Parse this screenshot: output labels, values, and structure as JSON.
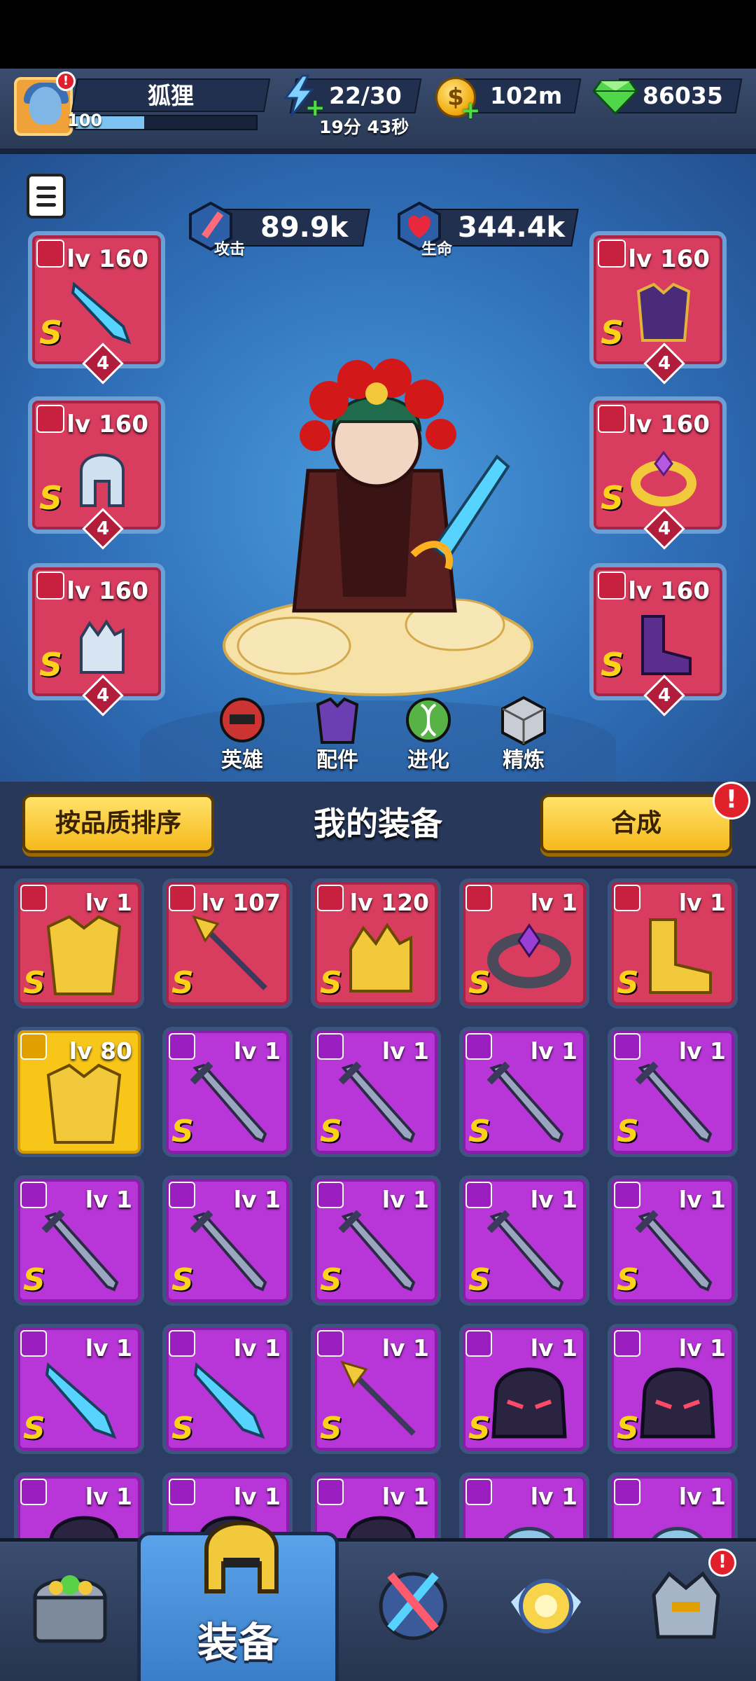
{
  "player": {
    "name": "狐狸",
    "level": "100",
    "xp_progress": 0.38
  },
  "resources": {
    "energy": "22/30",
    "energy_timer": "19分 43秒",
    "coins": "102m",
    "gems": "86035"
  },
  "stats": {
    "attack_value": "89.9k",
    "attack_label": "攻击",
    "hp_value": "344.4k",
    "hp_label": "生命"
  },
  "equipped": {
    "weapon": {
      "level": "lv 160",
      "grade": "S",
      "stars": "4",
      "art": "blade-icon"
    },
    "helmet": {
      "level": "lv 160",
      "grade": "S",
      "stars": "4",
      "art": "helmet-icon"
    },
    "gloves": {
      "level": "lv 160",
      "grade": "S",
      "stars": "4",
      "art": "gauntlet-icon"
    },
    "armor": {
      "level": "lv 160",
      "grade": "S",
      "stars": "4",
      "art": "armor-icon"
    },
    "ring": {
      "level": "lv 160",
      "grade": "S",
      "stars": "4",
      "art": "ring-icon"
    },
    "boots": {
      "level": "lv 160",
      "grade": "S",
      "stars": "4",
      "art": "boots-icon"
    }
  },
  "char_tabs": [
    "英雄",
    "配件",
    "进化",
    "精炼"
  ],
  "bag": {
    "sort_button": "按品质排序",
    "title": "我的装备",
    "merge_button": "合成",
    "merge_alert": "!"
  },
  "items": [
    {
      "level": "lv 1",
      "grade": "S",
      "rarity": "red",
      "art": "armor-icon"
    },
    {
      "level": "lv 107",
      "grade": "S",
      "rarity": "red",
      "art": "spear-icon"
    },
    {
      "level": "lv 120",
      "grade": "S",
      "rarity": "red",
      "art": "gauntlet-icon"
    },
    {
      "level": "lv 1",
      "grade": "S",
      "rarity": "red",
      "art": "ring-icon"
    },
    {
      "level": "lv 1",
      "grade": "S",
      "rarity": "red",
      "art": "boots-icon"
    },
    {
      "level": "lv 80",
      "grade": "",
      "rarity": "gold",
      "art": "armor-icon"
    },
    {
      "level": "lv 1",
      "grade": "S",
      "rarity": "purple",
      "art": "sword-icon"
    },
    {
      "level": "lv 1",
      "grade": "S",
      "rarity": "purple",
      "art": "sword-icon"
    },
    {
      "level": "lv 1",
      "grade": "S",
      "rarity": "purple",
      "art": "sword-icon"
    },
    {
      "level": "lv 1",
      "grade": "S",
      "rarity": "purple",
      "art": "sword-icon"
    },
    {
      "level": "lv 1",
      "grade": "S",
      "rarity": "purple",
      "art": "sword-icon"
    },
    {
      "level": "lv 1",
      "grade": "S",
      "rarity": "purple",
      "art": "sword-icon"
    },
    {
      "level": "lv 1",
      "grade": "S",
      "rarity": "purple",
      "art": "sword-icon"
    },
    {
      "level": "lv 1",
      "grade": "S",
      "rarity": "purple",
      "art": "sword-icon"
    },
    {
      "level": "lv 1",
      "grade": "S",
      "rarity": "purple",
      "art": "sword-icon"
    },
    {
      "level": "lv 1",
      "grade": "S",
      "rarity": "purple",
      "art": "blade-icon"
    },
    {
      "level": "lv 1",
      "grade": "S",
      "rarity": "purple",
      "art": "blade-icon"
    },
    {
      "level": "lv 1",
      "grade": "S",
      "rarity": "purple",
      "art": "spear-icon"
    },
    {
      "level": "lv 1",
      "grade": "S",
      "rarity": "purple",
      "art": "dark-helmet-icon"
    },
    {
      "level": "lv 1",
      "grade": "S",
      "rarity": "purple",
      "art": "dark-helmet-icon"
    },
    {
      "level": "lv 1",
      "grade": "",
      "rarity": "purple",
      "art": "dark-helmet-icon"
    },
    {
      "level": "lv 1",
      "grade": "",
      "rarity": "purple",
      "art": "dark-helmet-icon"
    },
    {
      "level": "lv 1",
      "grade": "",
      "rarity": "purple",
      "art": "dark-helmet-icon"
    },
    {
      "level": "lv 1",
      "grade": "",
      "rarity": "purple",
      "art": "steel-helmet-icon"
    },
    {
      "level": "lv 1",
      "grade": "",
      "rarity": "purple",
      "art": "steel-helmet-icon"
    }
  ],
  "nav": {
    "active_label": "装备",
    "alert": "!",
    "tabs": [
      "shop-chest-icon",
      "equipment-helmet-icon",
      "battle-swords-icon",
      "summon-orb-icon",
      "rank-helmet-icon"
    ]
  },
  "colors": {
    "rarity_red": "#d83c5e",
    "rarity_purple": "#b836d8",
    "rarity_gold": "#f7c619",
    "grade_s": "#ffd21a",
    "accent_button": "#f5b91b",
    "alert": "#e0202a"
  }
}
